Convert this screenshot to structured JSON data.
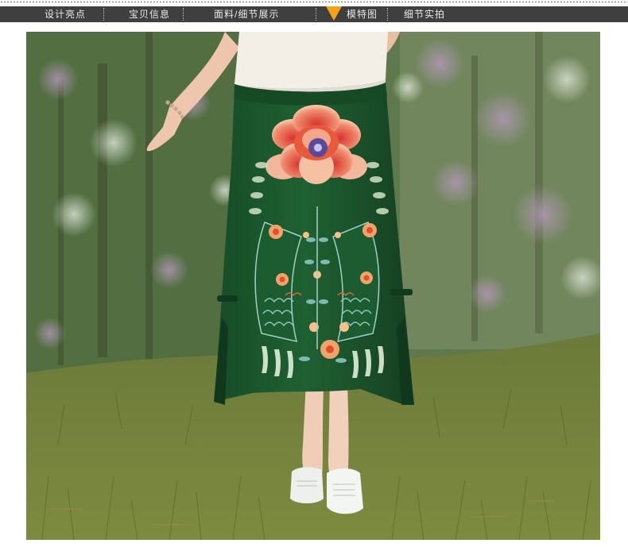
{
  "nav": {
    "items": [
      {
        "label": "设计亮点"
      },
      {
        "label": "宝贝信息"
      },
      {
        "label": "面料/细节展示"
      },
      {
        "label": "模特图"
      },
      {
        "label": "细节实拍"
      }
    ],
    "active_index": 3
  },
  "colors": {
    "nav_bg": "#3f3f3f",
    "nav_text": "#e8e8e8",
    "active_marker": "#f2a21a",
    "skirt_green": "#1d5a2e",
    "grass": "#7b8a3e"
  },
  "photo": {
    "subject": "model-wearing-embroidered-green-skirt"
  }
}
